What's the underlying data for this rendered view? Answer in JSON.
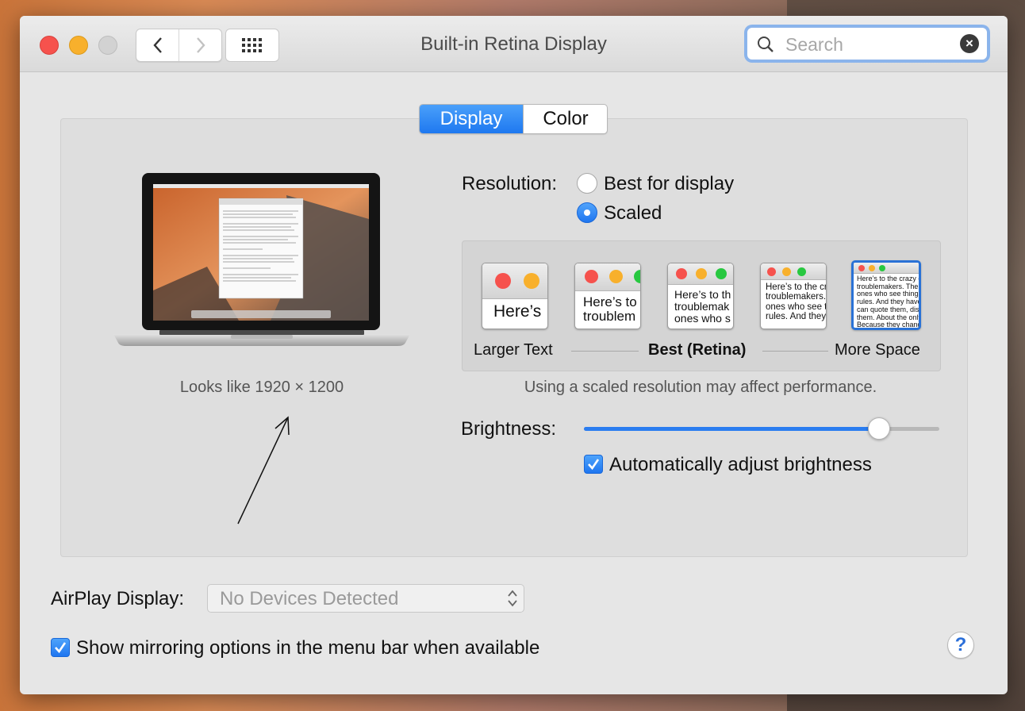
{
  "window": {
    "title": "Built-in Retina Display"
  },
  "search": {
    "placeholder": "Search"
  },
  "tabs": [
    {
      "label": "Display",
      "selected": true
    },
    {
      "label": "Color",
      "selected": false
    }
  ],
  "display_preview": {
    "looks_like": "Looks like 1920 × 1200"
  },
  "resolution": {
    "label": "Resolution:",
    "options": [
      {
        "label": "Best for display",
        "selected": false
      },
      {
        "label": "Scaled",
        "selected": true
      }
    ],
    "scale_thumbnails": [
      {
        "text": "Here’s",
        "selected": false
      },
      {
        "text": "Here’s to\ntroublem",
        "selected": false
      },
      {
        "text": "Here’s to th\ntroublemak\nones who s",
        "selected": false
      },
      {
        "text": "Here’s to the cr\ntroublemakers.\nones who see t\nrules. And they",
        "selected": false
      },
      {
        "text": "Here’s to the crazy ones\ntroublemakers. The rou\nones who see things dif\nrules. And they have no\ncan quote them, disagre\nthem. About the only th\nBecause they change th",
        "selected": true
      }
    ],
    "scale_labels": {
      "left": "Larger Text",
      "middle": "Best (Retina)",
      "right": "More Space"
    },
    "performance_note": "Using a scaled resolution may affect performance."
  },
  "brightness": {
    "label": "Brightness:",
    "level": 0.83
  },
  "auto_brightness": {
    "label": "Automatically adjust brightness",
    "checked": true
  },
  "airplay": {
    "label": "AirPlay Display:",
    "value": "No Devices Detected"
  },
  "mirroring": {
    "label": "Show mirroring options in the menu bar when available",
    "checked": true
  },
  "help": {
    "label": "?"
  },
  "colors": {
    "accent": "#1e78f0",
    "close": "#f6524d",
    "minimize": "#f8b02c",
    "help": "#2b6fd9"
  }
}
